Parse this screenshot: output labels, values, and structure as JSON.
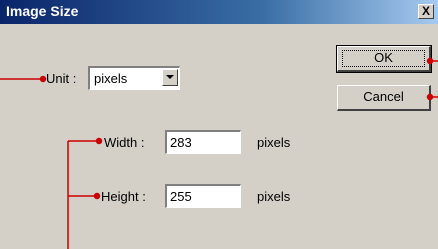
{
  "dialog": {
    "title": "Image Size",
    "close_label": "X"
  },
  "unit": {
    "label": "Unit :",
    "selected": "pixels"
  },
  "width": {
    "label": "Width :",
    "value": "283",
    "unit": "pixels"
  },
  "height": {
    "label": "Height :",
    "value": "255",
    "unit": "pixels"
  },
  "buttons": {
    "ok": "OK",
    "cancel": "Cancel"
  },
  "colors": {
    "titlebar": "#0a246a",
    "dialog_bg": "#d4d0c8",
    "callout": "#cc0000"
  }
}
